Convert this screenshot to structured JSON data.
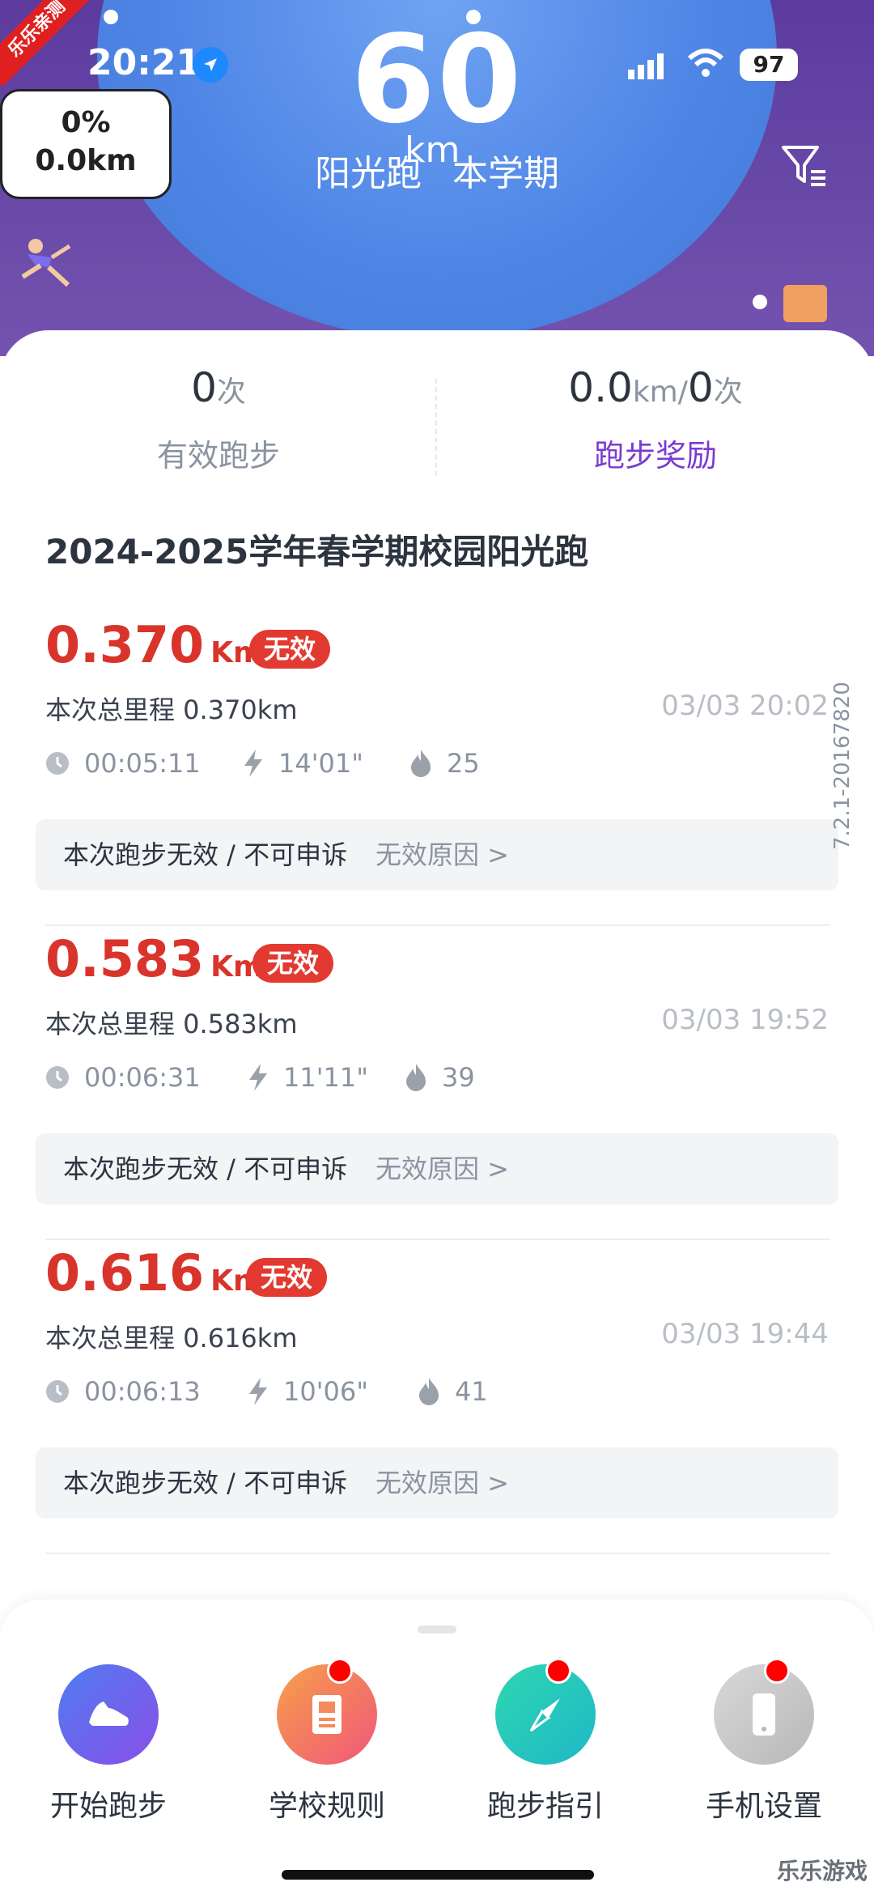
{
  "status": {
    "time": "20:21",
    "battery": "97"
  },
  "corner_badge": "乐乐亲测",
  "hero": {
    "distance_value": "60",
    "distance_unit": "km",
    "tab_left": "阳光跑",
    "tab_right": "本学期",
    "progress_pct": "0%",
    "progress_km": "0.0km"
  },
  "stats": {
    "valid_runs_value": "0",
    "valid_runs_unit": "次",
    "valid_runs_label": "有效跑步",
    "reward_km": "0.0",
    "reward_km_unit": "km/",
    "reward_count": "0",
    "reward_count_unit": "次",
    "reward_label": "跑步奖励"
  },
  "term_title": "2024-2025学年春学期校园阳光跑",
  "records": [
    {
      "km": "0.370",
      "unit": "Km",
      "badge": "无效",
      "total": "本次总里程 0.370km",
      "time": "03/03 20:02",
      "duration": "00:05:11",
      "pace": "14'01\"",
      "calories": "25",
      "notice": "本次跑步无效 / 不可申诉",
      "reason": "无效原因 >"
    },
    {
      "km": "0.583",
      "unit": "Km",
      "badge": "无效",
      "total": "本次总里程 0.583km",
      "time": "03/03 19:52",
      "duration": "00:06:31",
      "pace": "11'11\"",
      "calories": "39",
      "notice": "本次跑步无效 / 不可申诉",
      "reason": "无效原因 >"
    },
    {
      "km": "0.616",
      "unit": "Km",
      "badge": "无效",
      "total": "本次总里程 0.616km",
      "time": "03/03 19:44",
      "duration": "00:06:13",
      "pace": "10'06\"",
      "calories": "41",
      "notice": "本次跑步无效 / 不可申诉",
      "reason": "无效原因 >"
    }
  ],
  "version": "7.2.1-20167820",
  "nav": [
    {
      "label": "开始跑步",
      "icon": "shoe-icon"
    },
    {
      "label": "学校规则",
      "icon": "rulebook-icon"
    },
    {
      "label": "跑步指引",
      "icon": "compass-icon"
    },
    {
      "label": "手机设置",
      "icon": "phone-icon"
    }
  ],
  "watermark": "乐乐游戏",
  "colors": {
    "accent_red": "#d9342b",
    "purple": "#7a3bd1",
    "hero_bg": "#5b3b9e",
    "globe": "#4f86e6"
  }
}
